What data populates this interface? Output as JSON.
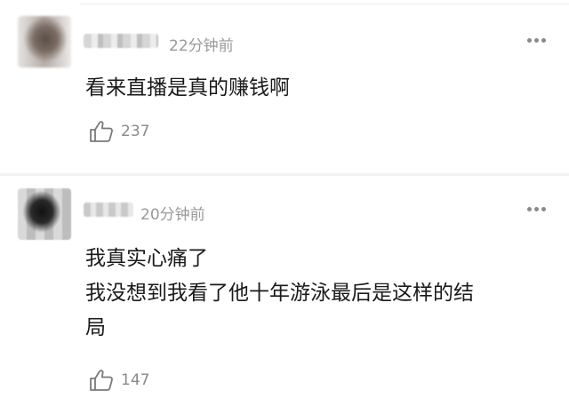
{
  "comments": [
    {
      "time": "22分钟前",
      "text_lines": [
        "看来直播是真的赚钱啊"
      ],
      "likes": "237",
      "more_icon": "more-horizontal-icon",
      "like_icon": "thumbs-up-icon"
    },
    {
      "time": "20分钟前",
      "text_lines": [
        "我真实心痛了",
        "我没想到我看了他十年游泳最后是这样的结",
        "局"
      ],
      "likes": "147",
      "more_icon": "more-horizontal-icon",
      "like_icon": "thumbs-up-icon"
    }
  ],
  "colors": {
    "text": "#1a1a1a",
    "meta": "#9a9a9a",
    "divider": "#f2f2f2"
  }
}
